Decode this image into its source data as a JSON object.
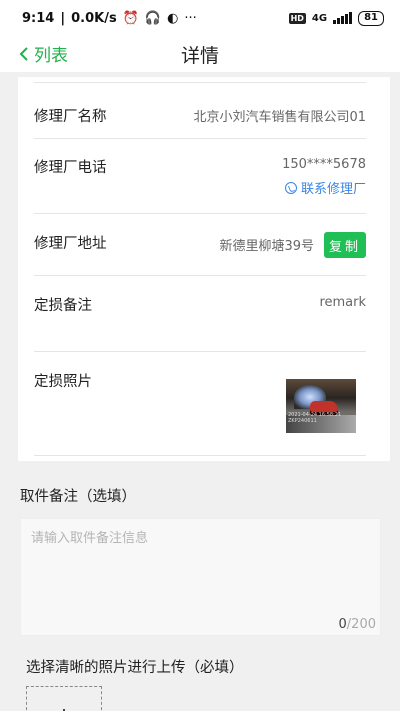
{
  "status_bar": {
    "time": "9:14",
    "net_speed": "0.0K/s",
    "hd": "HD",
    "net_type": "4G",
    "battery": "81"
  },
  "nav": {
    "back_label": "列表",
    "title": "详情"
  },
  "details": [
    {
      "label": "修理厂名称",
      "value": "北京小刘汽车销售有限公司01"
    },
    {
      "label": "修理厂电话",
      "value": "150****5678",
      "link": "联系修理厂"
    },
    {
      "label": "修理厂地址",
      "value": "新德里柳塘39号",
      "button": "复制"
    },
    {
      "label": "定损备注",
      "value": "remark"
    },
    {
      "label": "定损照片"
    }
  ],
  "photo": {
    "stamp_line1": "2021-04-24 16:58:21",
    "stamp_line2": "ZKP240611"
  },
  "pickup_remark": {
    "title": "取件备注（选填）",
    "placeholder": "请输入取件备注信息",
    "count_current": "0",
    "count_max": "/200"
  },
  "upload": {
    "title": "选择清晰的照片进行上传（必填）"
  }
}
